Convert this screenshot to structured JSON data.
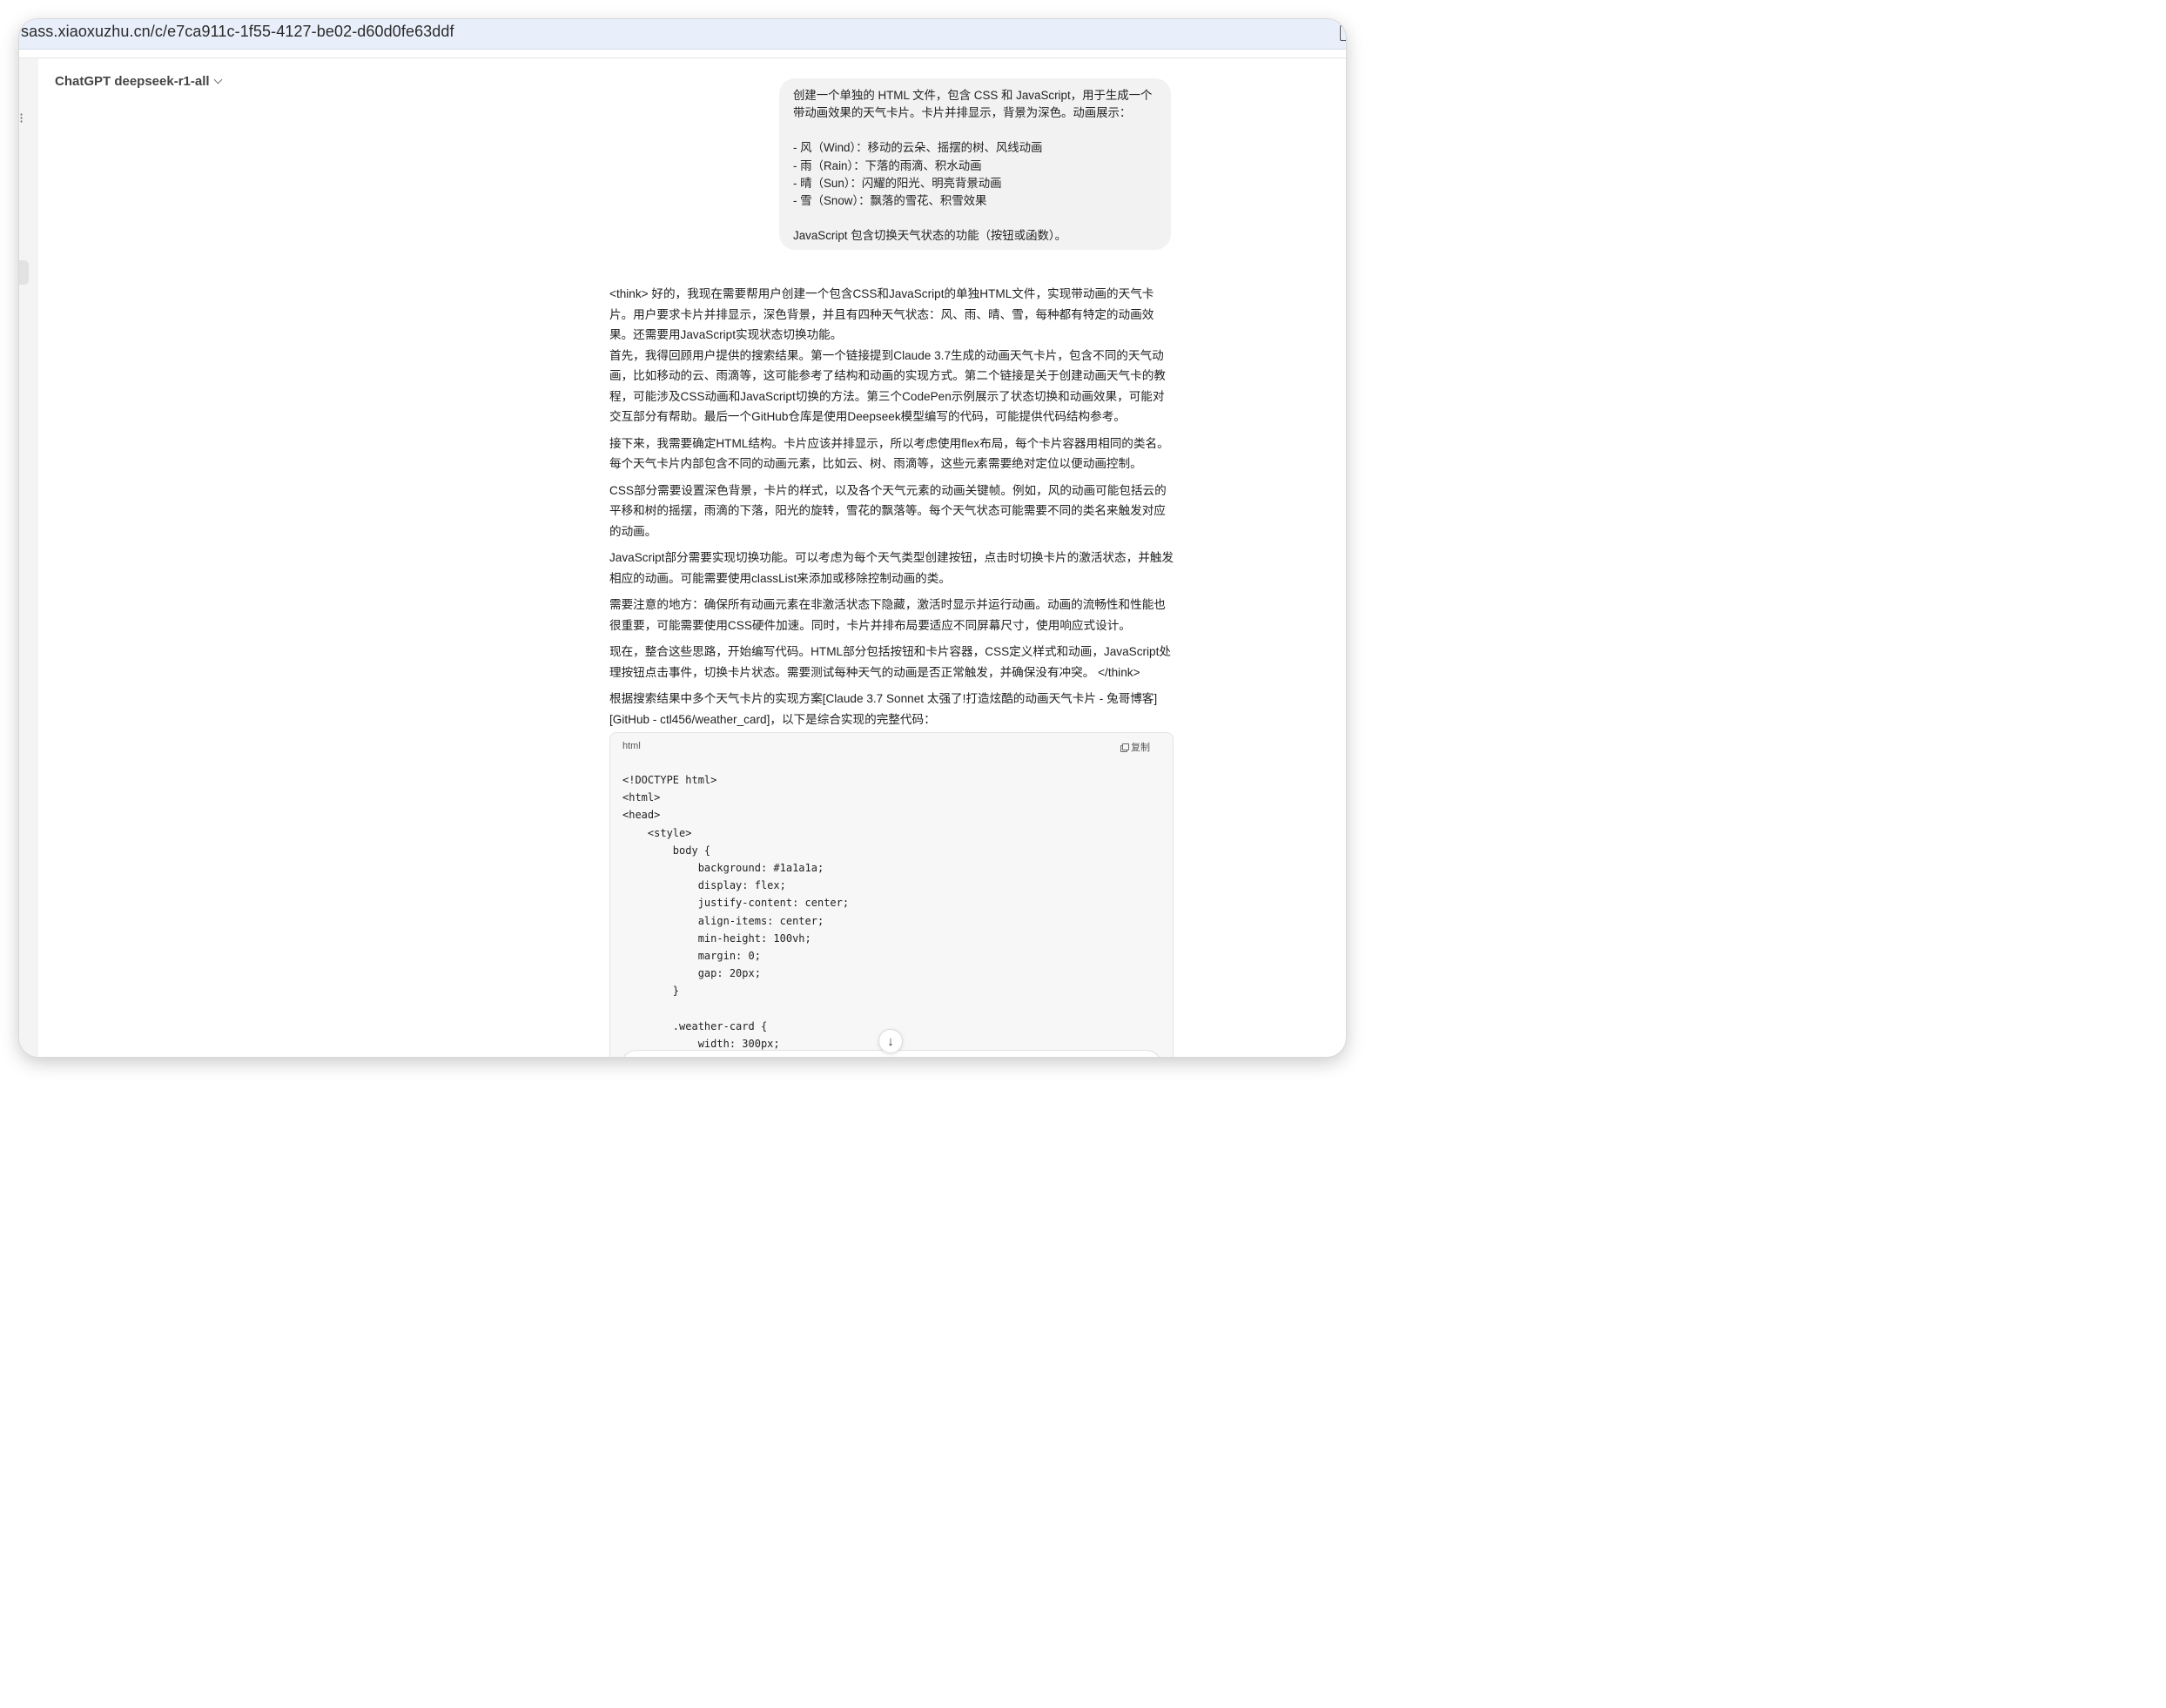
{
  "browser": {
    "url": "sass.xiaoxuzhu.cn/c/e7ca911c-1f55-4127-be02-d60d0fe63ddf"
  },
  "header": {
    "model_name": "ChatGPT deepseek-r1-all"
  },
  "user_message": {
    "lines": [
      "创建一个单独的 HTML 文件，包含 CSS 和 JavaScript，用于生成一个",
      "带动画效果的天气卡片。卡片并排显示，背景为深色。动画展示：",
      "",
      "- 风（Wind）：移动的云朵、摇摆的树、风线动画",
      "- 雨（Rain）：下落的雨滴、积水动画",
      "- 晴（Sun）：闪耀的阳光、明亮背景动画",
      "- 雪（Snow）：飘落的雪花、积雪效果",
      "",
      "JavaScript 包含切换天气状态的功能（按钮或函数）。"
    ]
  },
  "assistant_message": {
    "paragraphs": [
      "<think> 好的，我现在需要帮用户创建一个包含CSS和JavaScript的单独HTML文件，实现带动画的天气卡片。用户要求卡片并排显示，深色背景，并且有四种天气状态：风、雨、晴、雪，每种都有特定的动画效果。还需要用JavaScript实现状态切换功能。",
      "首先，我得回顾用户提供的搜索结果。第一个链接提到Claude 3.7生成的动画天气卡片，包含不同的天气动画，比如移动的云、雨滴等，这可能参考了结构和动画的实现方式。第二个链接是关于创建动画天气卡的教程，可能涉及CSS动画和JavaScript切换的方法。第三个CodePen示例展示了状态切换和动画效果，可能对交互部分有帮助。最后一个GitHub仓库是使用Deepseek模型编写的代码，可能提供代码结构参考。",
      "接下来，我需要确定HTML结构。卡片应该并排显示，所以考虑使用flex布局，每个卡片容器用相同的类名。每个天气卡片内部包含不同的动画元素，比如云、树、雨滴等，这些元素需要绝对定位以便动画控制。",
      "CSS部分需要设置深色背景，卡片的样式，以及各个天气元素的动画关键帧。例如，风的动画可能包括云的平移和树的摇摆，雨滴的下落，阳光的旋转，雪花的飘落等。每个天气状态可能需要不同的类名来触发对应的动画。",
      "JavaScript部分需要实现切换功能。可以考虑为每个天气类型创建按钮，点击时切换卡片的激活状态，并触发相应的动画。可能需要使用classList来添加或移除控制动画的类。",
      "需要注意的地方：确保所有动画元素在非激活状态下隐藏，激活时显示并运行动画。动画的流畅性和性能也很重要，可能需要使用CSS硬件加速。同时，卡片并排布局要适应不同屏幕尺寸，使用响应式设计。",
      "现在，整合这些思路，开始编写代码。HTML部分包括按钮和卡片容器，CSS定义样式和动画，JavaScript处理按钮点击事件，切换卡片状态。需要测试每种天气的动画是否正常触发，并确保没有冲突。 </think>",
      "根据搜索结果中多个天气卡片的实现方案[Claude 3.7 Sonnet 太强了!打造炫酷的动画天气卡片 - 兔哥博客][GitHub - ctl456/weather_card]，以下是综合实现的完整代码："
    ]
  },
  "code_block": {
    "language": "html",
    "copy_label": "复制",
    "lines": [
      "<!DOCTYPE html>",
      "<html>",
      "<head>",
      "    <style>",
      "        body {",
      "            background: #1a1a1a;",
      "            display: flex;",
      "            justify-content: center;",
      "            align-items: center;",
      "            min-height: 100vh;",
      "            margin: 0;",
      "            gap: 20px;",
      "        }",
      "",
      "        .weather-card {",
      "            width: 300px;"
    ]
  },
  "icons": {
    "model_dropdown": "chevron-down-icon",
    "copy": "copy-icon",
    "scroll": "arrow-down-icon",
    "sidebar": "sidebar-collapse-icon"
  },
  "colors": {
    "url_bar": "#e8eefa",
    "user_bubble": "#f2f2f2",
    "code_bg": "#f7f7f7"
  }
}
